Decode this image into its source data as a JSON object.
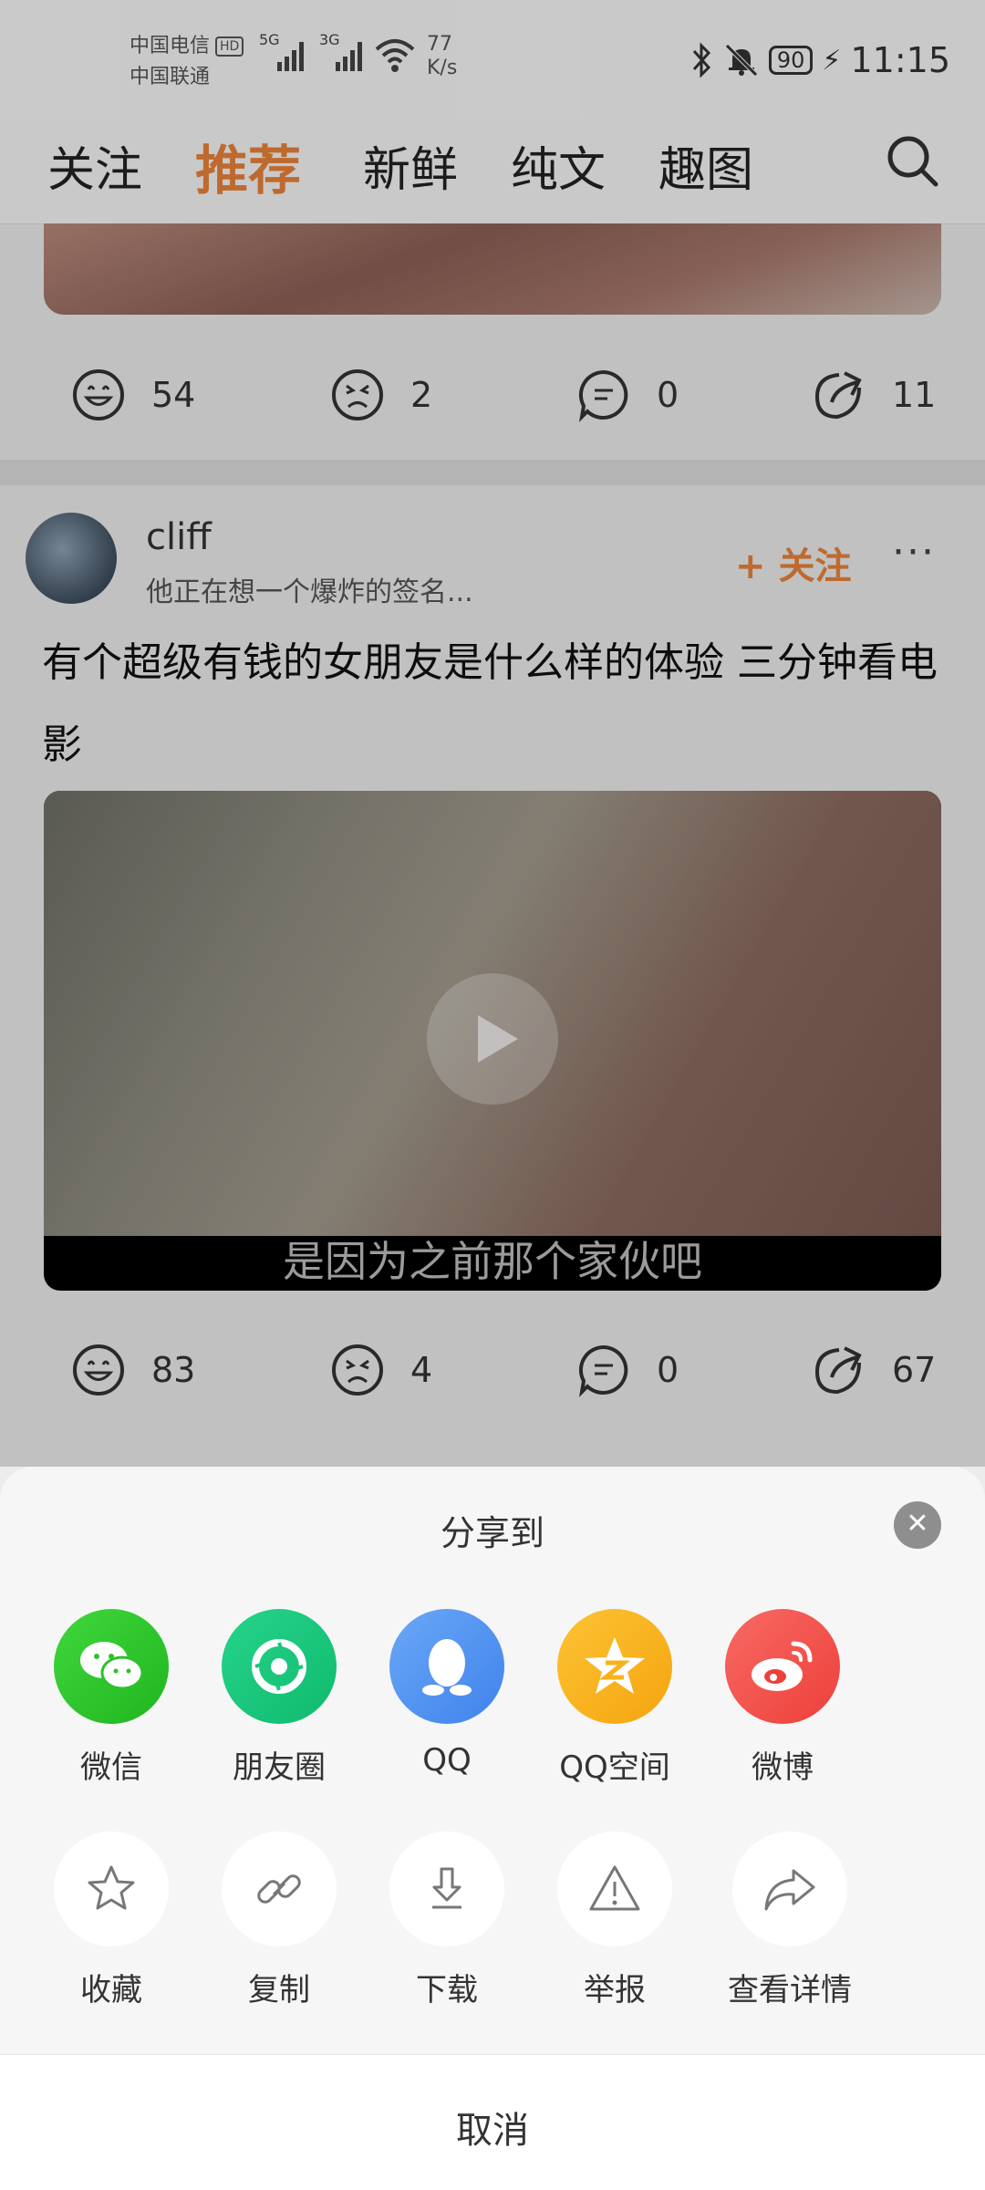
{
  "status_bar": {
    "carrier1": "中国电信",
    "hd": "HD",
    "carrier2": "中国联通",
    "sig1": "5G",
    "sig2": "3G",
    "speed_value": "77",
    "speed_unit": "K/s",
    "battery": "90",
    "time": "11:15"
  },
  "nav": {
    "tabs": [
      {
        "label": "关注"
      },
      {
        "label": "推荐"
      },
      {
        "label": "新鲜"
      },
      {
        "label": "纯文"
      },
      {
        "label": "趣图"
      }
    ]
  },
  "post1": {
    "likes": "54",
    "dislikes": "2",
    "comments": "0",
    "shares": "11"
  },
  "post2": {
    "username": "cliff",
    "signature": "他正在想一个爆炸的签名...",
    "follow_label": "+ 关注",
    "more_label": "···",
    "title": "有个超级有钱的女朋友是什么样的体验  三分钟看电影",
    "video_subtitle": "是因为之前那个家伙吧",
    "likes": "83",
    "dislikes": "4",
    "comments": "0",
    "shares": "67"
  },
  "share_sheet": {
    "title": "分享到",
    "targets": [
      {
        "label": "微信",
        "color": "#2dc12a"
      },
      {
        "label": "朋友圈",
        "color": "#15c87b"
      },
      {
        "label": "QQ",
        "color": "#4b8df0"
      },
      {
        "label": "QQ空间",
        "color": "#f7b21a"
      },
      {
        "label": "微博",
        "color": "#f4524d"
      }
    ],
    "actions": [
      {
        "label": "收藏",
        "icon": "star-icon"
      },
      {
        "label": "复制",
        "icon": "link-icon"
      },
      {
        "label": "下载",
        "icon": "download-icon"
      },
      {
        "label": "举报",
        "icon": "warning-icon"
      },
      {
        "label": "查看详情",
        "icon": "share-arrow-icon"
      }
    ],
    "cancel_label": "取消"
  }
}
